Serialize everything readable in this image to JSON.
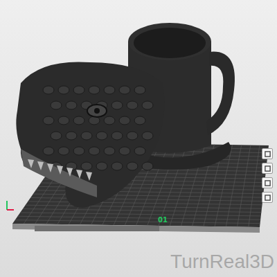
{
  "viewport": {
    "plate_number": "01"
  },
  "watermark": {
    "text": "TurnReal3D"
  }
}
